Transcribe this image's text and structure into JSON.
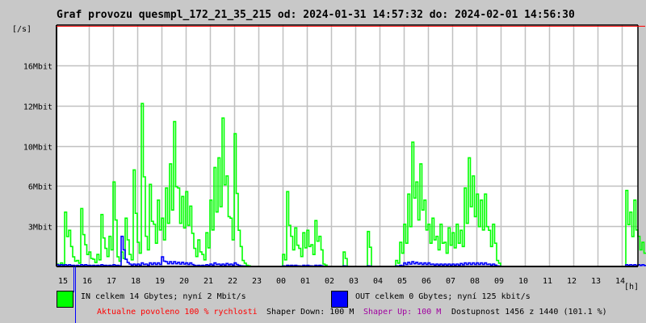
{
  "title": "Graf provozu quesmpl_172_21_35_215 od: 2024-01-31 14:57:32 do: 2024-02-01 14:56:30",
  "chart_data": {
    "type": "line",
    "title": "Graf provozu quesmpl_172_21_35_215 od: 2024-01-31 14:57:32 do: 2024-02-01 14:56:30",
    "ylabel": "[/s]",
    "xlabel": "[h]",
    "ylim": [
      0,
      20
    ],
    "y_unit": "Mbit/s",
    "y_ticks": [
      {
        "value": 3.33,
        "label": "3Mbit"
      },
      {
        "value": 6.67,
        "label": "6Mbit"
      },
      {
        "value": 10,
        "label": "10Mbit"
      },
      {
        "value": 13.33,
        "label": "12Mbit"
      },
      {
        "value": 16.67,
        "label": "16Mbit"
      }
    ],
    "x_ticks": [
      "15",
      "16",
      "17",
      "18",
      "19",
      "20",
      "21",
      "22",
      "23",
      "00",
      "01",
      "02",
      "03",
      "04",
      "05",
      "06",
      "07",
      "08",
      "09",
      "10",
      "11",
      "12",
      "13",
      "14"
    ],
    "sample_minutes": 10,
    "grid": true,
    "limit_line": {
      "value": 20,
      "color": "#ff0000"
    },
    "series": [
      {
        "name": "IN",
        "color": "#00ff00",
        "values": [
          0.2,
          0.3,
          4.5,
          3.0,
          0.8,
          0.5,
          4.8,
          1.8,
          1.2,
          0.6,
          1.0,
          4.3,
          1.5,
          2.5,
          7.0,
          0.8,
          1.2,
          4.0,
          1.0,
          8.0,
          2.0,
          13.5,
          2.5,
          6.8,
          3.5,
          5.5,
          4.0,
          6.5,
          8.5,
          12.0,
          6.5,
          5.8,
          6.2,
          5.0,
          1.5,
          2.2,
          1.0,
          2.8,
          5.5,
          8.2,
          9.0,
          12.3,
          7.5,
          4.0,
          11.0,
          3.0,
          0.5,
          0.1,
          0,
          0,
          0,
          0,
          0,
          0,
          0,
          0,
          1.0,
          6.2,
          2.5,
          3.2,
          1.5,
          2.8,
          3.0,
          1.8,
          3.8,
          2.5,
          0.2,
          0,
          0,
          0,
          0,
          1.2,
          0,
          0,
          0,
          0,
          0,
          2.9,
          0,
          0,
          0,
          0,
          0,
          0,
          0.5,
          2.0,
          3.5,
          6.0,
          10.3,
          7.0,
          8.5,
          5.5,
          3.5,
          4.0,
          2.5,
          3.5,
          2.0,
          3.2,
          2.8,
          3.5,
          3.0,
          6.5,
          9.0,
          7.5,
          6.0,
          5.5,
          6.0,
          3.0,
          3.5,
          0.5,
          0,
          0,
          0,
          0,
          0,
          0,
          0,
          0,
          0,
          0,
          0,
          0,
          0,
          0,
          0,
          0,
          0,
          0,
          0,
          0,
          0,
          0,
          0,
          0,
          0,
          0,
          0,
          0,
          0,
          0,
          0,
          6.3,
          4.5,
          5.5,
          2.5,
          2.0
        ]
      },
      {
        "name": "OUT",
        "color": "#0000ff",
        "values": [
          0.15,
          0.15,
          0.15,
          0.15,
          0.1,
          0.1,
          0.15,
          0.15,
          0.1,
          0.1,
          0.1,
          0.15,
          0.1,
          0.1,
          0.15,
          0.1,
          2.5,
          0.6,
          0.2,
          0.2,
          0.2,
          0.3,
          0.2,
          0.3,
          0.3,
          0.3,
          0.8,
          0.4,
          0.4,
          0.4,
          0.35,
          0.35,
          0.3,
          0.3,
          0.1,
          0.1,
          0.1,
          0.15,
          0.2,
          0.3,
          0.2,
          0.2,
          0.25,
          0.2,
          0.3,
          0.1,
          0.05,
          0,
          0,
          0,
          0,
          0,
          0,
          0,
          0,
          0,
          0.05,
          0.1,
          0.1,
          0.1,
          0.05,
          0.1,
          0.1,
          0.05,
          0.1,
          0.1,
          0,
          0,
          0,
          0,
          0,
          0.05,
          0,
          0,
          0,
          0,
          0,
          0.05,
          0,
          0,
          0,
          0,
          0,
          0,
          0.05,
          0.1,
          0.3,
          0.35,
          0.4,
          0.35,
          0.3,
          0.3,
          0.3,
          0.2,
          0.2,
          0.2,
          0.2,
          0.2,
          0.2,
          0.2,
          0.25,
          0.3,
          0.3,
          0.3,
          0.3,
          0.3,
          0.3,
          0.2,
          0.2,
          0.05,
          0,
          0,
          0,
          0,
          0,
          0,
          0,
          0,
          0,
          0,
          0,
          0,
          0,
          0,
          0,
          0,
          0,
          0,
          0,
          0,
          0,
          0,
          0,
          0,
          0,
          0,
          0,
          0,
          0,
          0,
          0,
          0.15,
          0.15,
          0.15,
          0.15,
          0.15
        ]
      }
    ]
  },
  "legend": {
    "in_text": "IN celkem 14 Gbytes; nyní 2 Mbit/s",
    "out_text": "OUT celkem 0 Gbytes; nyní 125 kbit/s",
    "in_color": "#00ff00",
    "out_color": "#0000ff"
  },
  "status": {
    "allowed": "Aktualne povoleno 100 % rychlosti",
    "shaper_down": "Shaper Down: 100 M",
    "shaper_up": "Shaper Up: 100 M",
    "availability": "Dostupnost 1456 z 1440 (101.1 %)"
  }
}
